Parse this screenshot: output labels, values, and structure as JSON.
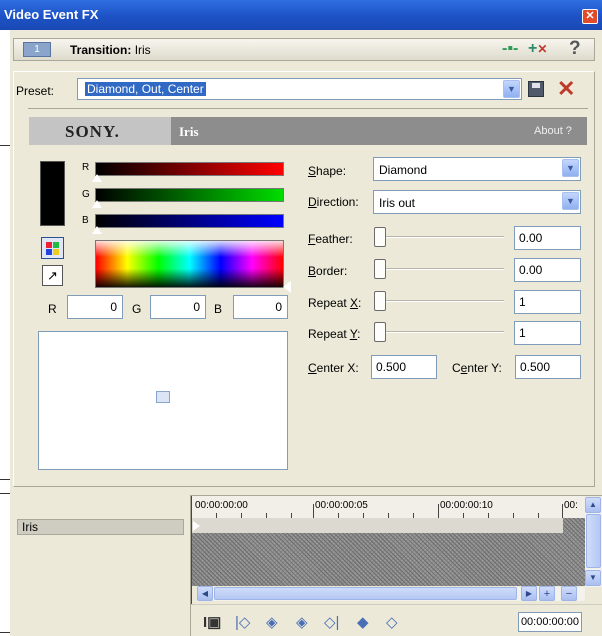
{
  "window": {
    "title": "Video Event FX",
    "close": "✕"
  },
  "header": {
    "track_number": "1",
    "transition_prefix": "Transition:",
    "transition_name": "Iris",
    "help": "?"
  },
  "preset": {
    "label": "Preset:",
    "value": "Diamond, Out, Center"
  },
  "banner": {
    "brand": "SONY.",
    "plugin_name": "Iris",
    "about": "About ?"
  },
  "color": {
    "channels": [
      "R",
      "G",
      "B"
    ],
    "r": "0",
    "g": "0",
    "b": "0",
    "swatch_color": "#000000"
  },
  "params": {
    "shape": {
      "label_u": "S",
      "label_rest": "hape:",
      "value": "Diamond"
    },
    "direction": {
      "label_u": "D",
      "label_rest": "irection:",
      "value": "Iris out"
    },
    "feather": {
      "label_u": "F",
      "label_rest": "eather:",
      "value": "0.00",
      "level": 0
    },
    "border": {
      "label_u": "B",
      "label_rest": "order:",
      "value": "0.00",
      "level": 0
    },
    "repeat_x": {
      "label_pre": "Repeat ",
      "label_u": "X",
      "label_rest": ":",
      "value": "1",
      "level": 0
    },
    "repeat_y": {
      "label_pre": "Repeat ",
      "label_u": "Y",
      "label_rest": ":",
      "value": "1",
      "level": 0
    },
    "center_x": {
      "label_u": "C",
      "label_rest": "enter X:",
      "value": "0.500"
    },
    "center_y": {
      "label_pre": "C",
      "label_u": "e",
      "label_rest": "nter Y:",
      "value": "0.500"
    }
  },
  "timeline": {
    "track_label": "Iris",
    "ruler": [
      "00:00:00:00",
      "00:00:00:05",
      "00:00:00:10",
      "00:"
    ],
    "timecode": "00:00:00:00"
  },
  "colors": {
    "titlebar": "#1d52c6",
    "window_bg": "#ece9d8",
    "selection": "#316ac5"
  }
}
